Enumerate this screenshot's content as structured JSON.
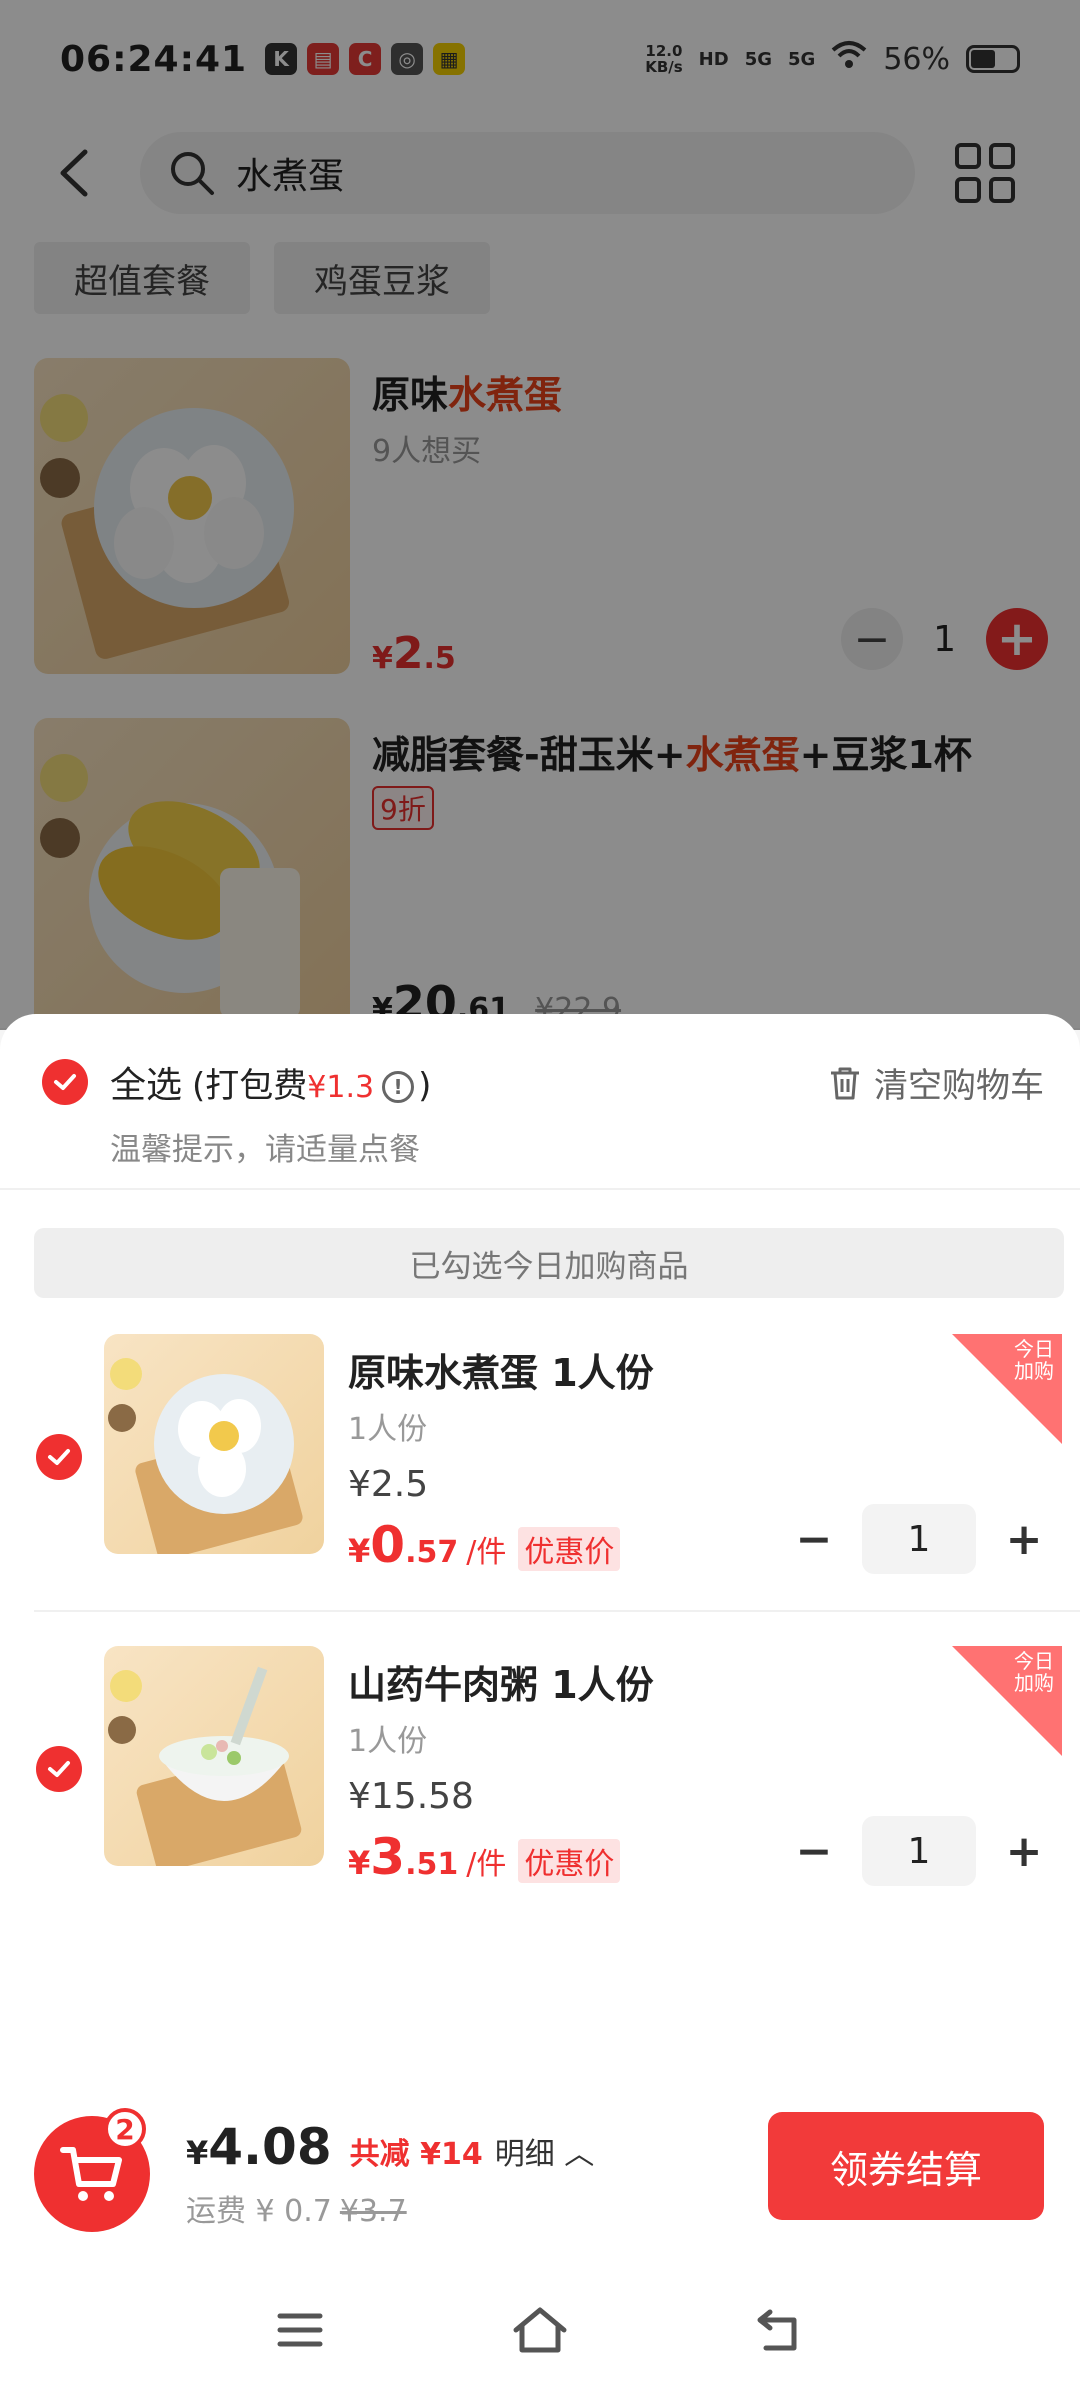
{
  "status_bar": {
    "time": "06:24:41",
    "net_speed_top": "12.0",
    "net_speed_unit": "KB/s",
    "hd": "HD",
    "sig1": "5G",
    "sig2": "5G",
    "battery": "56%"
  },
  "search": {
    "query": "水煮蛋"
  },
  "chips": [
    "超值套餐",
    "鸡蛋豆浆"
  ],
  "products": [
    {
      "name_prefix": "原味",
      "name_highlight": "水煮蛋",
      "sub": "9人想买",
      "price_yen": "¥",
      "price_big": "2",
      "price_small": ".5",
      "qty": "1"
    },
    {
      "name_prefix": "减脂套餐-甜玉米+",
      "name_highlight": "水煮蛋",
      "name_suffix": "+豆浆1杯",
      "discount_tag": "9折",
      "price_yen": "¥",
      "price_big": "20",
      "price_small": ".61",
      "price_old": "¥22.9"
    }
  ],
  "cart": {
    "select_all": "全选",
    "pack_label": "(打包费",
    "pack_fee": "¥1.3",
    "pack_close": ")",
    "info_icon": "!",
    "clear_label": "清空购物车",
    "tip": "温馨提示，请适量点餐",
    "section_title": "已勾选今日加购商品",
    "items": [
      {
        "name": "原味水煮蛋 1人份",
        "spec": "1人份",
        "orig_price": "¥2.5",
        "deal_yen": "¥",
        "deal_big": "0",
        "deal_small": ".57",
        "deal_unit": "/件",
        "deal_tag": "优惠价",
        "today_tag_line1": "今日",
        "today_tag_line2": "加购",
        "qty": "1"
      },
      {
        "name": "山药牛肉粥 1人份",
        "spec": "1人份",
        "orig_price": "¥15.58",
        "deal_yen": "¥",
        "deal_big": "3",
        "deal_small": ".51",
        "deal_unit": "/件",
        "deal_tag": "优惠价",
        "today_tag_line1": "今日",
        "today_tag_line2": "加购",
        "qty": "1"
      }
    ]
  },
  "checkout": {
    "badge": "2",
    "yen": "¥",
    "total": "4.08",
    "saved": "共减 ¥14",
    "detail": "明细",
    "ship_label": "运费 ¥ 0.7",
    "ship_old": "¥3.7",
    "pay_label": "领券结算"
  },
  "colors": {
    "accent": "#ef3030",
    "highlight": "#e9431a"
  }
}
